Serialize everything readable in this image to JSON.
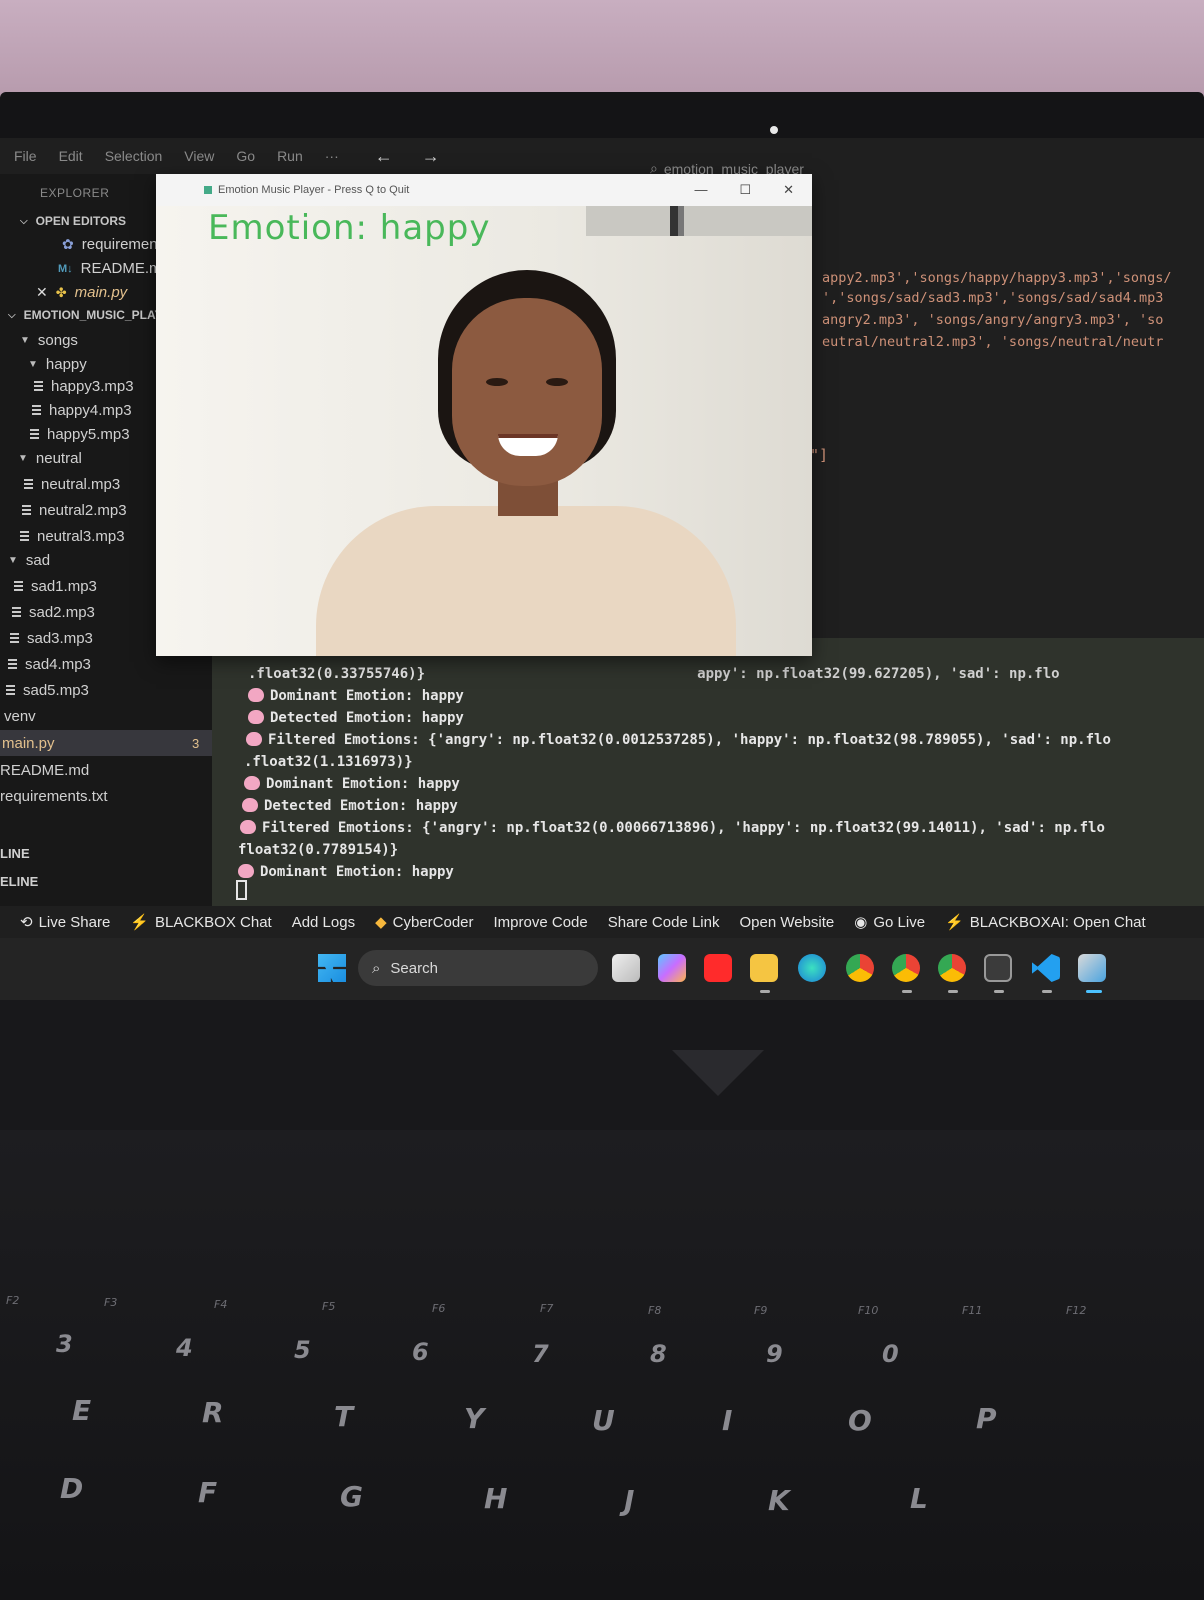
{
  "menu": {
    "items": [
      "File",
      "Edit",
      "Selection",
      "View",
      "Go",
      "Run",
      "···"
    ],
    "nav_arrows": "← →",
    "search_text": "emotion_music_player"
  },
  "sidebar": {
    "explorer_title": "EXPLORER",
    "open_editors_title": "OPEN EDITORS",
    "open_editors": [
      "requirements.t",
      "README.md",
      "main.py"
    ],
    "project_title": "EMOTION_MUSIC_PLAYE",
    "songs": "songs",
    "happy": "happy",
    "happy_files": [
      "happy3.mp3",
      "happy4.mp3",
      "happy5.mp3"
    ],
    "neutral": "neutral",
    "neutral_files": [
      "neutral.mp3",
      "neutral2.mp3",
      "neutral3.mp3"
    ],
    "sad": "sad",
    "sad_files": [
      "sad1.mp3",
      "sad2.mp3",
      "sad3.mp3",
      "sad4.mp3",
      "sad5.mp3"
    ],
    "venv": "venv",
    "main_py": "main.py",
    "main_py_badge": "3",
    "readme": "README.md",
    "requirements": "requirements.txt",
    "outline": "LINE",
    "timeline": "ELINE"
  },
  "editor": {
    "lines": [
      "appy2.mp3','songs/happy/happy3.mp3','songs/",
      "','songs/sad/sad3.mp3','songs/sad/sad4.mp3",
      "angry2.mp3', 'songs/angry/angry3.mp3', 'so",
      "eutral/neutral2.mp3', 'songs/neutral/neutr"
    ],
    "closing_bracket": "\"]"
  },
  "cv_window": {
    "title": "Emotion Music Player - Press Q to Quit",
    "emotion_text": "Emotion: happy"
  },
  "terminal": {
    "lines": [
      "                                                      appy': np.float32(99.627205), 'sad': np.flo",
      ".float32(0.33755746)}",
      "Dominant Emotion: happy",
      "Detected Emotion: happy",
      "Filtered Emotions: {'angry': np.float32(0.0012537285), 'happy': np.float32(98.789055), 'sad': np.flo",
      ".float32(1.1316973)}",
      "Dominant Emotion: happy",
      "Detected Emotion: happy",
      "Filtered Emotions: {'angry': np.float32(0.00066713896), 'happy': np.float32(99.14011), 'sad': np.flo",
      "float32(0.7789154)}",
      "Dominant Emotion: happy"
    ]
  },
  "statusbar": {
    "live_share": "Live Share",
    "blackbox_chat": "BLACKBOX Chat",
    "add_logs": "Add Logs",
    "cybercoder": "CyberCoder",
    "improve_code": "Improve Code",
    "share_code_link": "Share Code Link",
    "open_website": "Open Website",
    "go_live": "Go Live",
    "blackboxai_open_chat": "BLACKBOXAI: Open Chat"
  },
  "taskbar": {
    "search_label": "Search",
    "icons": [
      "task-view-icon",
      "copilot-icon",
      "youtube-icon",
      "file-explorer-icon",
      "edge-icon",
      "chrome-icon",
      "chrome-profile-icon",
      "chrome-alt-icon",
      "terminal-icon",
      "vscode-icon",
      "python-app-icon"
    ]
  },
  "keyboard": {
    "fkeys": [
      "F2",
      "F3",
      "F4",
      "F5",
      "F6",
      "F7",
      "F8",
      "F9",
      "F10",
      "F11",
      "F12"
    ],
    "numbers": [
      "3",
      "4",
      "5",
      "6",
      "7",
      "8",
      "9",
      "0"
    ],
    "top_letters": [
      "E",
      "R",
      "T",
      "Y",
      "U",
      "I",
      "O",
      "P"
    ],
    "home_letters": [
      "D",
      "F",
      "G",
      "H",
      "J",
      "K",
      "L"
    ]
  },
  "colors": {
    "emotion_label": "#49b85a",
    "code_string": "#ce9178",
    "terminal_bg": "#2f332c",
    "brain_icon": "#f2a7c3"
  }
}
